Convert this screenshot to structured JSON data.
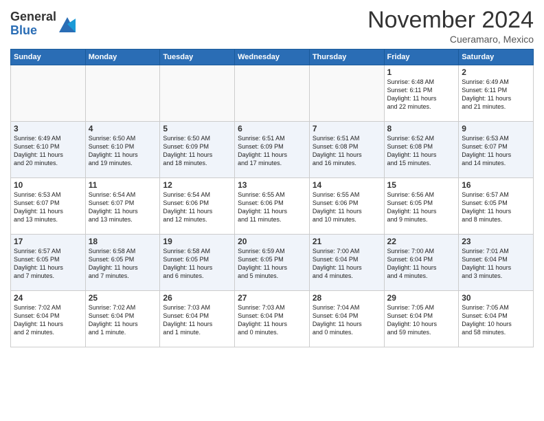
{
  "logo": {
    "general": "General",
    "blue": "Blue"
  },
  "title": "November 2024",
  "location": "Cueramaro, Mexico",
  "days_of_week": [
    "Sunday",
    "Monday",
    "Tuesday",
    "Wednesday",
    "Thursday",
    "Friday",
    "Saturday"
  ],
  "weeks": [
    [
      {
        "day": "",
        "info": ""
      },
      {
        "day": "",
        "info": ""
      },
      {
        "day": "",
        "info": ""
      },
      {
        "day": "",
        "info": ""
      },
      {
        "day": "",
        "info": ""
      },
      {
        "day": "1",
        "info": "Sunrise: 6:48 AM\nSunset: 6:11 PM\nDaylight: 11 hours\nand 22 minutes."
      },
      {
        "day": "2",
        "info": "Sunrise: 6:49 AM\nSunset: 6:11 PM\nDaylight: 11 hours\nand 21 minutes."
      }
    ],
    [
      {
        "day": "3",
        "info": "Sunrise: 6:49 AM\nSunset: 6:10 PM\nDaylight: 11 hours\nand 20 minutes."
      },
      {
        "day": "4",
        "info": "Sunrise: 6:50 AM\nSunset: 6:10 PM\nDaylight: 11 hours\nand 19 minutes."
      },
      {
        "day": "5",
        "info": "Sunrise: 6:50 AM\nSunset: 6:09 PM\nDaylight: 11 hours\nand 18 minutes."
      },
      {
        "day": "6",
        "info": "Sunrise: 6:51 AM\nSunset: 6:09 PM\nDaylight: 11 hours\nand 17 minutes."
      },
      {
        "day": "7",
        "info": "Sunrise: 6:51 AM\nSunset: 6:08 PM\nDaylight: 11 hours\nand 16 minutes."
      },
      {
        "day": "8",
        "info": "Sunrise: 6:52 AM\nSunset: 6:08 PM\nDaylight: 11 hours\nand 15 minutes."
      },
      {
        "day": "9",
        "info": "Sunrise: 6:53 AM\nSunset: 6:07 PM\nDaylight: 11 hours\nand 14 minutes."
      }
    ],
    [
      {
        "day": "10",
        "info": "Sunrise: 6:53 AM\nSunset: 6:07 PM\nDaylight: 11 hours\nand 13 minutes."
      },
      {
        "day": "11",
        "info": "Sunrise: 6:54 AM\nSunset: 6:07 PM\nDaylight: 11 hours\nand 13 minutes."
      },
      {
        "day": "12",
        "info": "Sunrise: 6:54 AM\nSunset: 6:06 PM\nDaylight: 11 hours\nand 12 minutes."
      },
      {
        "day": "13",
        "info": "Sunrise: 6:55 AM\nSunset: 6:06 PM\nDaylight: 11 hours\nand 11 minutes."
      },
      {
        "day": "14",
        "info": "Sunrise: 6:55 AM\nSunset: 6:06 PM\nDaylight: 11 hours\nand 10 minutes."
      },
      {
        "day": "15",
        "info": "Sunrise: 6:56 AM\nSunset: 6:05 PM\nDaylight: 11 hours\nand 9 minutes."
      },
      {
        "day": "16",
        "info": "Sunrise: 6:57 AM\nSunset: 6:05 PM\nDaylight: 11 hours\nand 8 minutes."
      }
    ],
    [
      {
        "day": "17",
        "info": "Sunrise: 6:57 AM\nSunset: 6:05 PM\nDaylight: 11 hours\nand 7 minutes."
      },
      {
        "day": "18",
        "info": "Sunrise: 6:58 AM\nSunset: 6:05 PM\nDaylight: 11 hours\nand 7 minutes."
      },
      {
        "day": "19",
        "info": "Sunrise: 6:58 AM\nSunset: 6:05 PM\nDaylight: 11 hours\nand 6 minutes."
      },
      {
        "day": "20",
        "info": "Sunrise: 6:59 AM\nSunset: 6:05 PM\nDaylight: 11 hours\nand 5 minutes."
      },
      {
        "day": "21",
        "info": "Sunrise: 7:00 AM\nSunset: 6:04 PM\nDaylight: 11 hours\nand 4 minutes."
      },
      {
        "day": "22",
        "info": "Sunrise: 7:00 AM\nSunset: 6:04 PM\nDaylight: 11 hours\nand 4 minutes."
      },
      {
        "day": "23",
        "info": "Sunrise: 7:01 AM\nSunset: 6:04 PM\nDaylight: 11 hours\nand 3 minutes."
      }
    ],
    [
      {
        "day": "24",
        "info": "Sunrise: 7:02 AM\nSunset: 6:04 PM\nDaylight: 11 hours\nand 2 minutes."
      },
      {
        "day": "25",
        "info": "Sunrise: 7:02 AM\nSunset: 6:04 PM\nDaylight: 11 hours\nand 1 minute."
      },
      {
        "day": "26",
        "info": "Sunrise: 7:03 AM\nSunset: 6:04 PM\nDaylight: 11 hours\nand 1 minute."
      },
      {
        "day": "27",
        "info": "Sunrise: 7:03 AM\nSunset: 6:04 PM\nDaylight: 11 hours\nand 0 minutes."
      },
      {
        "day": "28",
        "info": "Sunrise: 7:04 AM\nSunset: 6:04 PM\nDaylight: 11 hours\nand 0 minutes."
      },
      {
        "day": "29",
        "info": "Sunrise: 7:05 AM\nSunset: 6:04 PM\nDaylight: 10 hours\nand 59 minutes."
      },
      {
        "day": "30",
        "info": "Sunrise: 7:05 AM\nSunset: 6:04 PM\nDaylight: 10 hours\nand 58 minutes."
      }
    ]
  ]
}
